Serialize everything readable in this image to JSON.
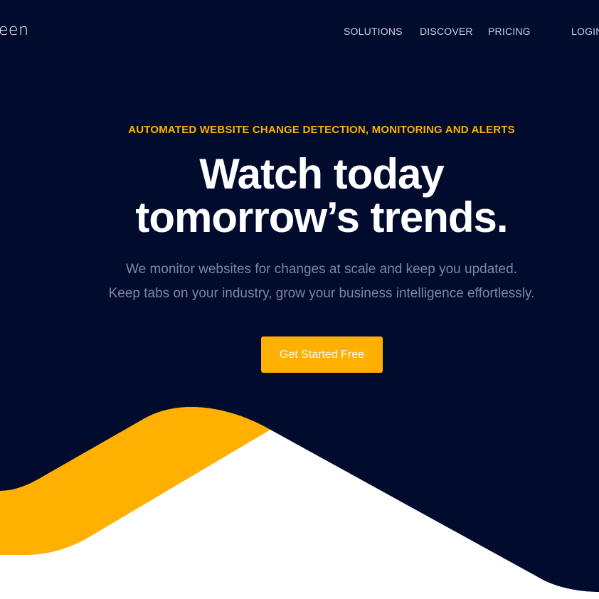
{
  "header": {
    "logo_text": "een",
    "nav": {
      "solutions": "SOLUTIONS",
      "discover": "DISCOVER",
      "pricing": "PRICING",
      "login": "LOGIN"
    }
  },
  "hero": {
    "eyebrow": "AUTOMATED WEBSITE CHANGE DETECTION, MONITORING AND ALERTS",
    "headline_line1": "Watch today",
    "headline_line2": "tomorrow’s trends.",
    "sub_line1": "We monitor websites for changes at scale and keep you updated.",
    "sub_line2": "Keep tabs on your industry, grow your business intelligence effortlessly.",
    "cta_label": "Get Started Free"
  },
  "colors": {
    "navy": "#000b2e",
    "accent": "#ffb000",
    "white": "#ffffff",
    "muted_text": "#7e84a3"
  }
}
